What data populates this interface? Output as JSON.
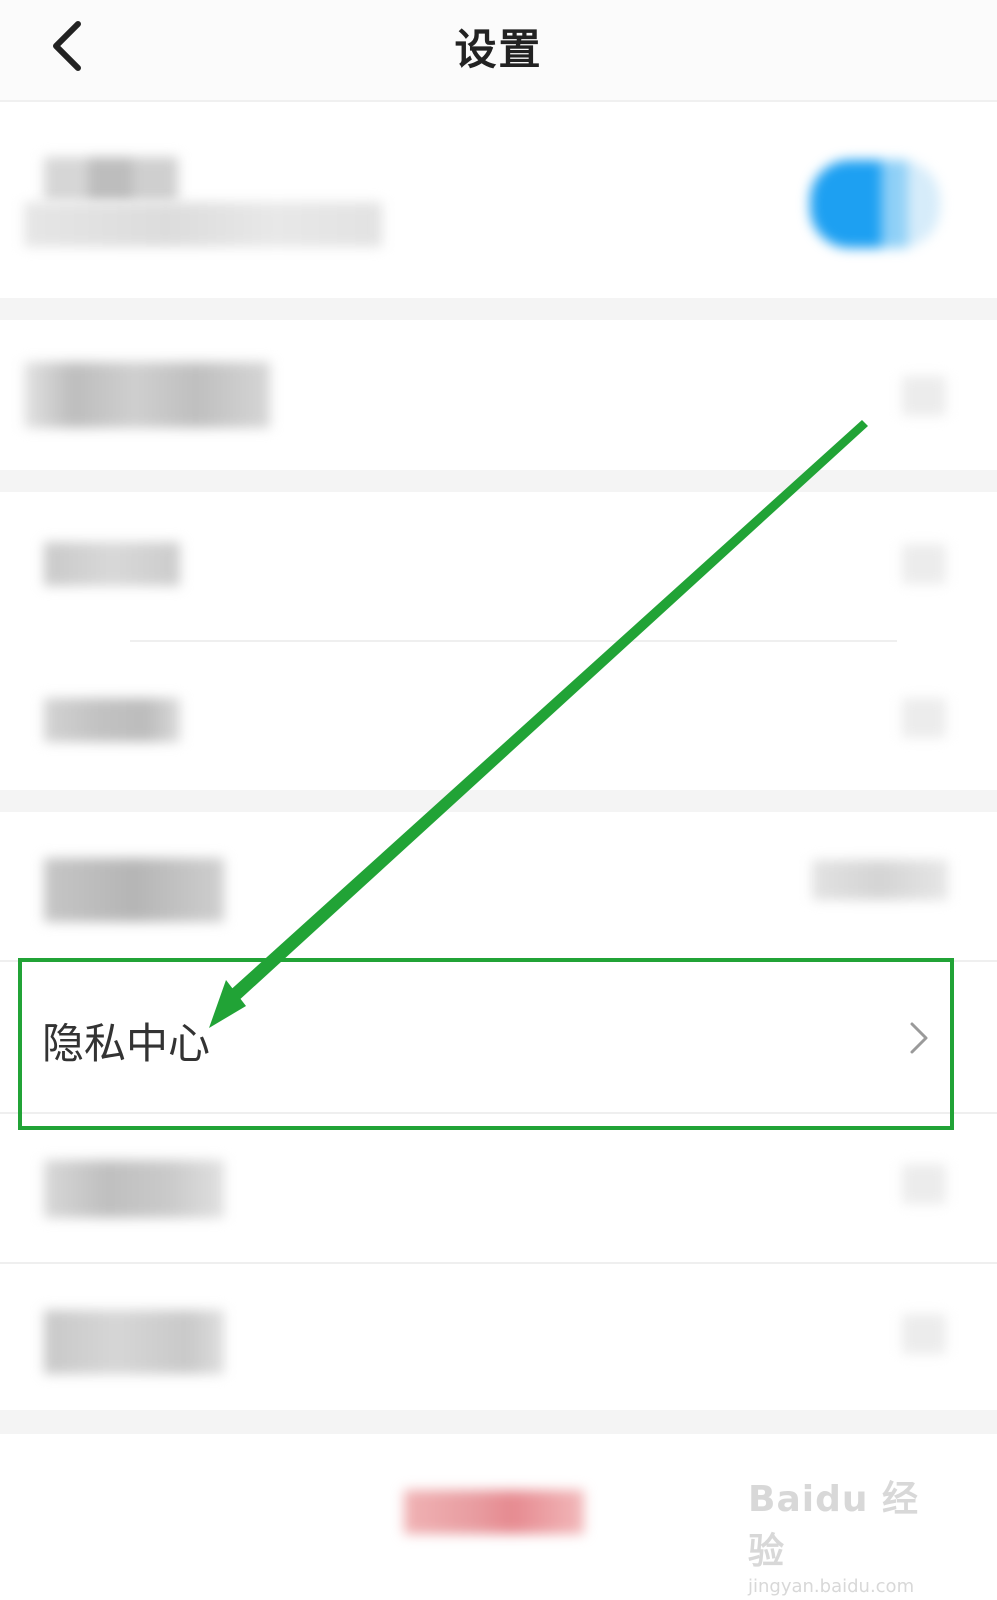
{
  "header": {
    "title": "设置"
  },
  "privacy_row": {
    "label": "隐私中心"
  },
  "watermark": {
    "brand": "Baidu 经验",
    "url": "jingyan.baidu.com"
  }
}
